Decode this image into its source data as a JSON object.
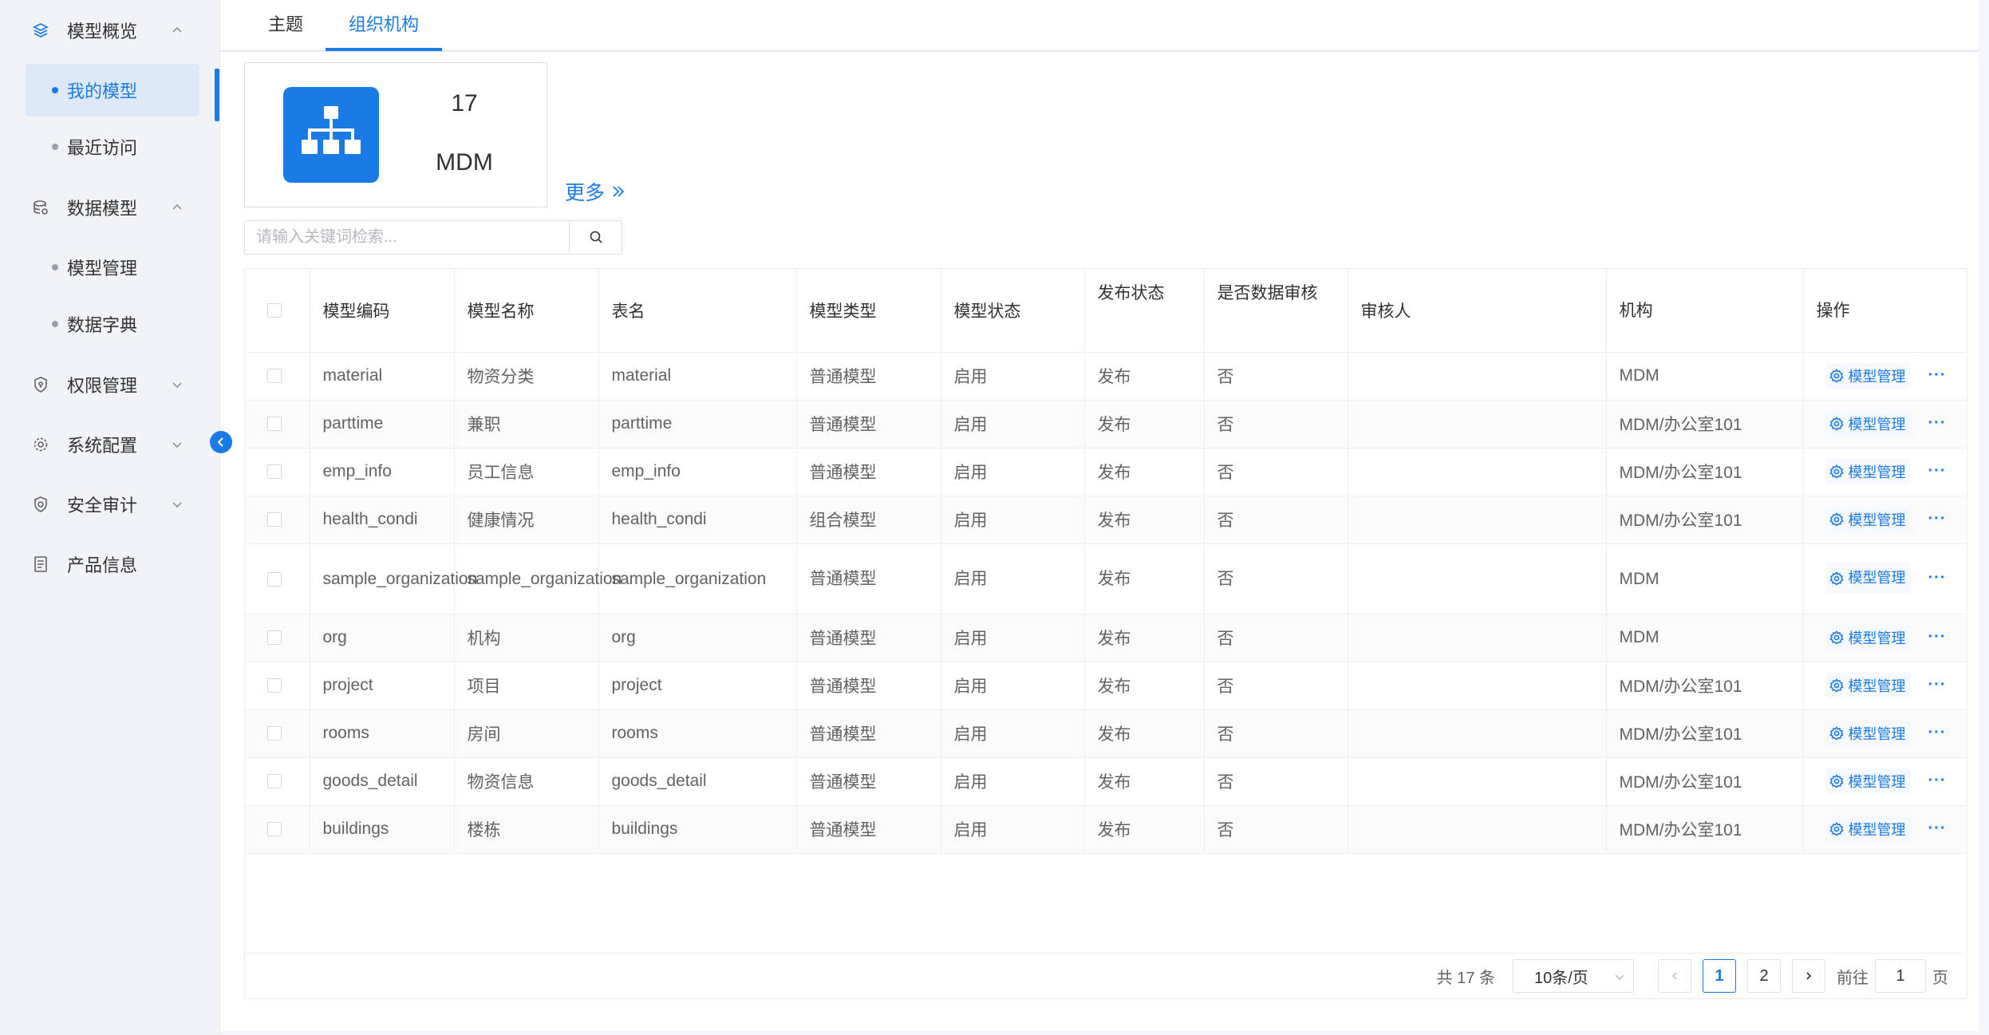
{
  "sidebar": {
    "groups": [
      {
        "label": "模型概览",
        "icon": "layers-icon",
        "expanded": true,
        "active": true
      },
      {
        "label": "数据模型",
        "icon": "database-icon",
        "expanded": true
      },
      {
        "label": "权限管理",
        "icon": "shield-icon",
        "expanded": false
      },
      {
        "label": "系统配置",
        "icon": "gear-icon",
        "expanded": false
      },
      {
        "label": "安全审计",
        "icon": "audit-shield-icon",
        "expanded": false
      },
      {
        "label": "产品信息",
        "icon": "document-icon"
      }
    ],
    "overview_items": [
      {
        "label": "我的模型",
        "active": true
      },
      {
        "label": "最近访问"
      }
    ],
    "data_model_items": [
      {
        "label": "模型管理"
      },
      {
        "label": "数据字典"
      }
    ]
  },
  "tabs": [
    {
      "label": "主题"
    },
    {
      "label": "组织机构",
      "active": true
    }
  ],
  "org_card": {
    "count": "17",
    "name": "MDM",
    "icon": "org-chart-icon"
  },
  "more_label": "更多",
  "search": {
    "placeholder": "请输入关键词检索...",
    "value": ""
  },
  "table": {
    "headers": [
      "模型编码",
      "模型名称",
      "表名",
      "模型类型",
      "模型状态",
      "发布状态",
      "是否数据审核",
      "审核人",
      "机构",
      "操作"
    ],
    "rows": [
      {
        "code": "material",
        "name": "物资分类",
        "table": "material",
        "type": "普通模型",
        "status": "启用",
        "publish": "发布",
        "audit": "否",
        "auditor": "",
        "org": "MDM"
      },
      {
        "code": "parttime",
        "name": "兼职",
        "table": "parttime",
        "type": "普通模型",
        "status": "启用",
        "publish": "发布",
        "audit": "否",
        "auditor": "",
        "org": "MDM/办公室101"
      },
      {
        "code": "emp_info",
        "name": "员工信息",
        "table": "emp_info",
        "type": "普通模型",
        "status": "启用",
        "publish": "发布",
        "audit": "否",
        "auditor": "",
        "org": "MDM/办公室101"
      },
      {
        "code": "health_condi",
        "name": "健康情况",
        "table": "health_condi",
        "type": "组合模型",
        "status": "启用",
        "publish": "发布",
        "audit": "否",
        "auditor": "",
        "org": "MDM/办公室101"
      },
      {
        "code": "sample_organization",
        "name": "sample_organization",
        "table": "sample_organization",
        "type": "普通模型",
        "status": "启用",
        "publish": "发布",
        "audit": "否",
        "auditor": "",
        "org": "MDM"
      },
      {
        "code": "org",
        "name": "机构",
        "table": "org",
        "type": "普通模型",
        "status": "启用",
        "publish": "发布",
        "audit": "否",
        "auditor": "",
        "org": "MDM"
      },
      {
        "code": "project",
        "name": "项目",
        "table": "project",
        "type": "普通模型",
        "status": "启用",
        "publish": "发布",
        "audit": "否",
        "auditor": "",
        "org": "MDM/办公室101"
      },
      {
        "code": "rooms",
        "name": "房间",
        "table": "rooms",
        "type": "普通模型",
        "status": "启用",
        "publish": "发布",
        "audit": "否",
        "auditor": "",
        "org": "MDM/办公室101"
      },
      {
        "code": "goods_detail",
        "name": "物资信息",
        "table": "goods_detail",
        "type": "普通模型",
        "status": "启用",
        "publish": "发布",
        "audit": "否",
        "auditor": "",
        "org": "MDM/办公室101"
      },
      {
        "code": "buildings",
        "name": "楼栋",
        "table": "buildings",
        "type": "普通模型",
        "status": "启用",
        "publish": "发布",
        "audit": "否",
        "auditor": "",
        "org": "MDM/办公室101"
      }
    ],
    "action_label": "模型管理",
    "more_label": "···"
  },
  "pagination": {
    "total_text": "共 17 条",
    "page_size": "10条/页",
    "pages": [
      "1",
      "2"
    ],
    "current_page": "1",
    "goto_label": "前往",
    "goto_value": "1",
    "page_suffix": "页"
  },
  "colors": {
    "accent": "#1a7ae6",
    "text": "#303133",
    "muted": "#5f6266"
  }
}
